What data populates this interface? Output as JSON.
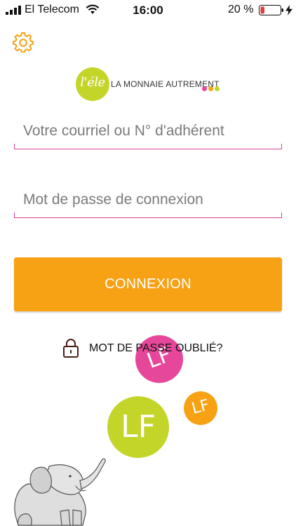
{
  "status_bar": {
    "carrier": "El Telecom",
    "time": "16:00",
    "battery_percent": "20 %",
    "battery_level": 0.2,
    "icons": [
      "signal-icon",
      "wifi-icon",
      "battery-icon",
      "charging-bolt-icon"
    ]
  },
  "header": {
    "settings_icon": "gear-icon"
  },
  "logo": {
    "circle_text": "l'éle",
    "tagline": "LA MONNAIE AUTREMENT",
    "dot_colors": [
      "#e6479a",
      "#f7a214",
      "#c4d52a"
    ]
  },
  "login_form": {
    "email_placeholder": "Votre courriel ou N° d'adhérent",
    "email_value": "",
    "password_placeholder": "Mot de passe de connexion",
    "password_value": "",
    "submit_label": "CONNEXION"
  },
  "forgot_password": {
    "label": "MOT DE PASSE OUBLIÉ?",
    "icon": "lock-icon"
  },
  "decoration": {
    "bubbles": [
      {
        "name": "pink-lf-bubble",
        "text": "LF",
        "color": "#e6479a"
      },
      {
        "name": "orange-lf-bubble",
        "text": "LF",
        "color": "#f7a214"
      },
      {
        "name": "green-lf-bubble",
        "text": "LF",
        "color": "#c4d52a"
      }
    ]
  },
  "colors": {
    "accent_orange": "#f7a214",
    "accent_pink": "#d9409a",
    "accent_green": "#c4d52a"
  }
}
